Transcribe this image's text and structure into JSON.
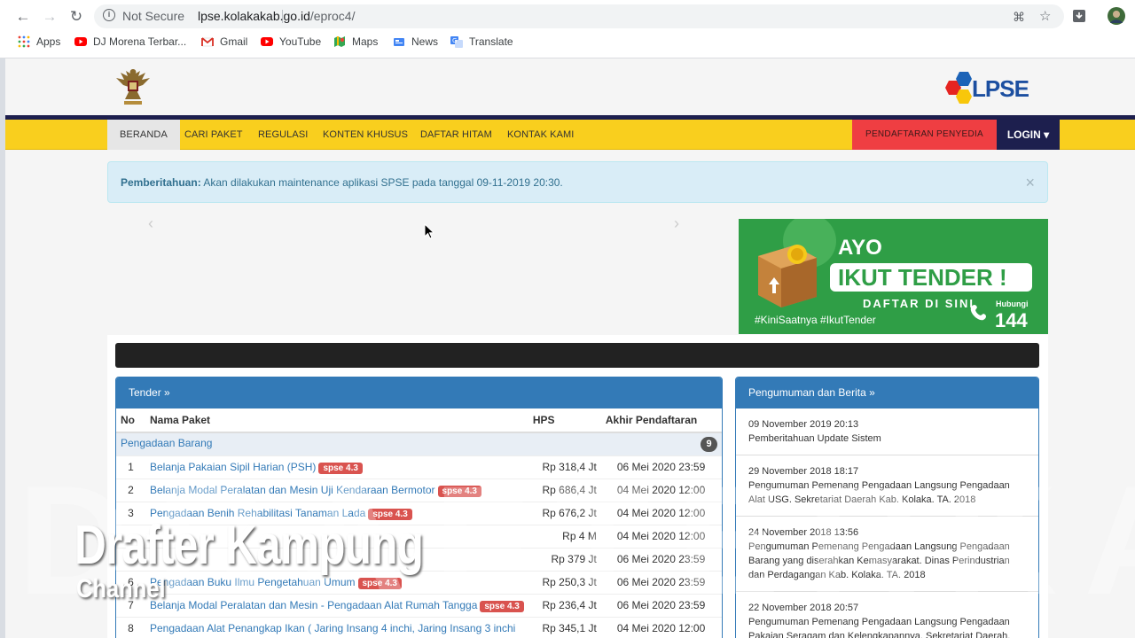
{
  "browser": {
    "security_label": "Not Secure",
    "url_host": "lpse.kolakakab.go.id",
    "url_path": "/eproc4/",
    "bookmarks": [
      {
        "label": "Apps",
        "icon": "apps-grid-icon"
      },
      {
        "label": "DJ Morena Terbar...",
        "icon": "youtube-icon"
      },
      {
        "label": "Gmail",
        "icon": "gmail-icon"
      },
      {
        "label": "YouTube",
        "icon": "youtube-icon"
      },
      {
        "label": "Maps",
        "icon": "maps-icon"
      },
      {
        "label": "News",
        "icon": "news-icon"
      },
      {
        "label": "Translate",
        "icon": "translate-icon"
      }
    ]
  },
  "site": {
    "logo_text": "LPSE",
    "nav": [
      "BERANDA",
      "CARI PAKET",
      "REGULASI",
      "KONTEN KHUSUS",
      "DAFTAR HITAM",
      "KONTAK KAMI"
    ],
    "register_label": "PENDAFTARAN PENYEDIA",
    "login_label": "LOGIN"
  },
  "alert": {
    "label": "Pemberitahuan:",
    "text": " Akan dilakukan maintenance aplikasi SPSE pada tanggal 09-11-2019 20:30.",
    "close": "×"
  },
  "banner": {
    "line1": "AYO",
    "line2": "IKUT TENDER !",
    "line3": "DAFTAR DI SINI",
    "tags": "#KiniSaatnya #IkutTender",
    "hubungi": "Hubungi",
    "number": "144"
  },
  "tender": {
    "title": "Tender »",
    "columns": [
      "No",
      "Nama Paket",
      "HPS",
      "Akhir Pendaftaran"
    ],
    "group": "Pengadaan Barang",
    "group_count": "9",
    "rows": [
      {
        "no": "1",
        "name": "Belanja Pakaian Sipil Harian (PSH)",
        "badge": "spse 4.3",
        "hps": "Rp 318,4 Jt",
        "deadline": "06 Mei 2020 23:59"
      },
      {
        "no": "2",
        "name": "Belanja Modal Peralatan dan Mesin Uji Kendaraan Bermotor",
        "badge": "spse 4.3",
        "hps": "Rp 686,4 Jt",
        "deadline": "04 Mei 2020 12:00"
      },
      {
        "no": "3",
        "name": "Pengadaan Benih Rehabilitasi Tanaman Lada",
        "badge": "spse 4.3",
        "hps": "Rp 676,2 Jt",
        "deadline": "04 Mei 2020 12:00"
      },
      {
        "no": "",
        "name": "",
        "badge": "",
        "hps": "Rp 4 M",
        "deadline": "04 Mei 2020 12:00"
      },
      {
        "no": "",
        "name": "",
        "badge": "",
        "hps": "Rp 379 Jt",
        "deadline": "06 Mei 2020 23:59"
      },
      {
        "no": "6",
        "name": "Pengadaan Buku Ilmu Pengetahuan Umum",
        "badge": "spse 4.3",
        "hps": "Rp 250,3 Jt",
        "deadline": "06 Mei 2020 23:59"
      },
      {
        "no": "7",
        "name": "Belanja Modal Peralatan dan Mesin - Pengadaan Alat Rumah Tangga",
        "badge": "spse 4.3",
        "hps": "Rp 236,4 Jt",
        "deadline": "06 Mei 2020 23:59"
      },
      {
        "no": "8",
        "name": "Pengadaan Alat Penangkap Ikan ( Jaring Insang 4 inchi, Jaring Insang 3 inchi",
        "badge": "",
        "hps": "Rp 345,1 Jt",
        "deadline": "04 Mei 2020 12:00"
      }
    ]
  },
  "berita": {
    "title": "Pengumuman dan Berita »",
    "items": [
      {
        "date": "09 November 2019 20:13",
        "text": "Pemberitahuan Update Sistem"
      },
      {
        "date": "29 November 2018 18:17",
        "text": "Pengumuman Pemenang Pengadaan Langsung Pengadaan Alat USG. Sekretariat Daerah Kab. Kolaka. TA. 2018"
      },
      {
        "date": "24 November 2018 13:56",
        "text": "Pengumuman Pemenang Pengadaan Langsung Pengadaan Barang yang diserahkan Kemasyarakat. Dinas Perindustrian dan Perdagangan Kab. Kolaka. TA. 2018"
      },
      {
        "date": "22 November 2018 20:57",
        "text": "Pengumuman Pemenang Pengadaan Langsung Pengadaan Pakaian Seragam dan Kelengkapannya. Sekretariat Daerah."
      }
    ]
  },
  "overlay": {
    "watermark": "DRAFTERKAMPUNG",
    "title": "Drafter Kampung",
    "subtitle": "Channel"
  }
}
